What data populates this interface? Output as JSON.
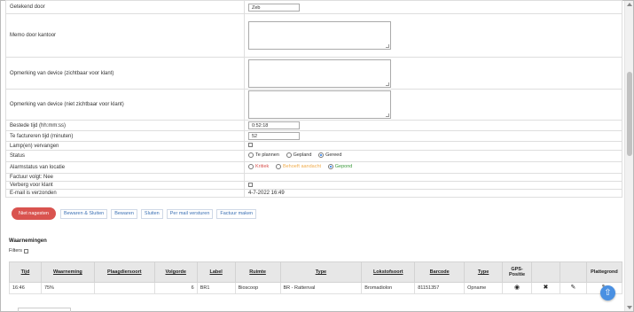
{
  "form": {
    "signed_by_label": "Getekend door",
    "signed_by_value": "Zeb",
    "memo_label": "Memo door kantoor",
    "remark_visible_label": "Opmerking van device (zichtbaar voor klant)",
    "remark_hidden_label": "Opmerking van device (niet zichtbaar voor klant)",
    "time_spent_label": "Bestede tijd (hh:mm:ss)",
    "time_spent_value": "0:52:18",
    "time_invoice_label": "Te factureren tijd (minuten)",
    "time_invoice_value": "52",
    "lamps_label": "Lamp(en) vervangen",
    "status_label": "Status",
    "status_options": [
      "Te plannen",
      "Gepland",
      "Gereed"
    ],
    "status_selected": "Gereed",
    "alarm_label": "Alarmstatus van locatie",
    "alarm_options": [
      "Kritiek",
      "Behoeft aandacht",
      "Gepond"
    ],
    "alarm_selected": "Gepond",
    "invoice_label": "Factuur volgt: Nee",
    "hide_label": "Verberg voor klant",
    "email_label": "E-mail is verzonden",
    "email_value": "4-7-2022 16:49"
  },
  "buttons": {
    "cancel": "Niet nagesten",
    "save_close": "Bewaren & Sluiten",
    "save": "Bewaren",
    "close": "Sluiten",
    "mail": "Per mail versturen",
    "invoice": "Factuur maken"
  },
  "observations": {
    "title": "Waarnemingen",
    "filters_label": "Filters",
    "headers": [
      "Tijd",
      "Waarneming",
      "Plaagdiersoort",
      "Volgorde",
      "Label",
      "Ruimte",
      "Type",
      "Lokstofsoort",
      "Barcode",
      "Type",
      "GPS-Positie",
      "",
      "",
      "Plattegrond"
    ],
    "rows": [
      {
        "tijd": "16:46",
        "waarneming": "75%",
        "plaagdiersoort": "",
        "volgorde": "6",
        "label": "BR1",
        "ruimte": "Bioscoop",
        "type": "BR - Rattenval",
        "lokstofsoort": "Bromadiolon",
        "barcode": "81151357",
        "type2": "Opname"
      }
    ]
  },
  "icons": {
    "gps": "gps-target-icon",
    "delete": "close-x-icon",
    "edit": "edit-note-icon",
    "map": "map-pencil-icon",
    "scroll_top": "arrow-up-icon"
  },
  "colors": {
    "primary_button": "#d9534f",
    "link_button": "#3a6fb3",
    "radio_red": "#d9534f",
    "radio_orange": "#f0ad4e",
    "radio_green": "#3c9a3c",
    "fab": "#4a90e2"
  }
}
